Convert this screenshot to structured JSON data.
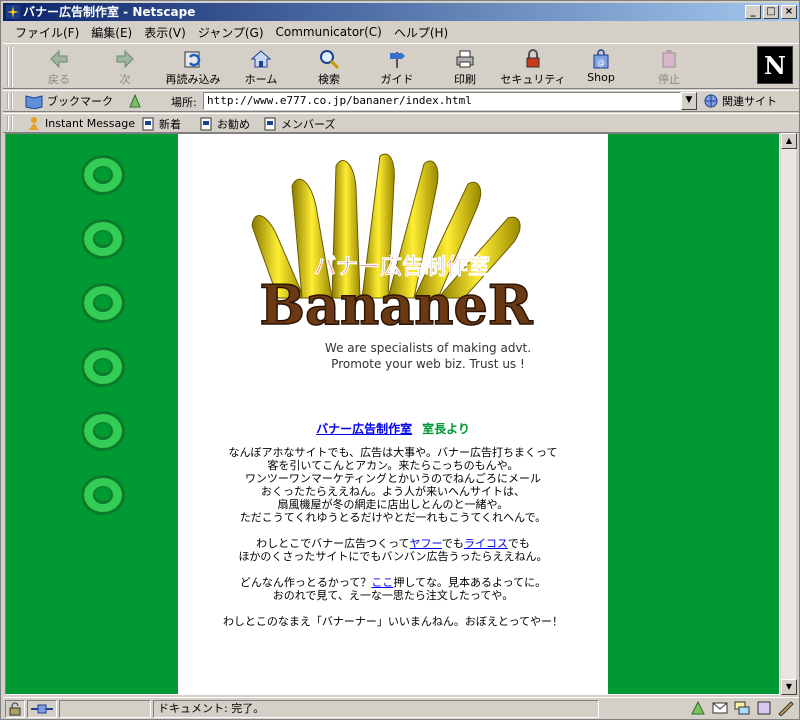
{
  "window": {
    "title": "バナー広告制作室 - Netscape"
  },
  "window_buttons": {
    "minimize": "_",
    "maximize": "□",
    "close": "×"
  },
  "menu": [
    "ファイル(F)",
    "編集(E)",
    "表示(V)",
    "ジャンプ(G)",
    "Communicator(C)",
    "ヘルプ(H)"
  ],
  "toolbar": {
    "back": "戻る",
    "forward": "次",
    "reload": "再読み込み",
    "home": "ホーム",
    "search": "検索",
    "guide": "ガイド",
    "print": "印刷",
    "security": "セキュリティ",
    "shop": "Shop",
    "stop": "停止"
  },
  "brand": {
    "logo_letter": "N"
  },
  "location": {
    "bookmarks_label": "ブックマーク",
    "label": "場所:",
    "url": "http://www.e777.co.jp/bananer/index.html",
    "related_label": "関連サイト"
  },
  "personal_toolbar": [
    "Instant Message",
    "新着",
    "お勧め",
    "メンバーズ"
  ],
  "banner": {
    "jp_title": "バナー広告制作室",
    "logo_text": "BananeR",
    "tagline1": "We are specialists of making advt.",
    "tagline2": "Promote your web biz. Trust us !"
  },
  "heading": {
    "link": "バナー広告制作室",
    "suffix": "室長より"
  },
  "paragraphs": {
    "p1": [
      "なんぼアホなサイトでも、広告は大事や。バナー広告打ちまくって",
      "客を引いてこんとアカン。来たらこっちのもんや。",
      "ワンツーワンマーケティングとかいうのでねんごろにメール",
      "おくったたらええねん。よう人が来いへんサイトは、",
      "扇風機屋が冬の網走に店出しとんのと一緒や。",
      "ただこうてくれゆうとるだけやとだ一れもこうてくれへんで。"
    ],
    "p2_a": "わしとこでバナー広告つくって",
    "p2_link1": "ヤフー",
    "p2_b": "でも",
    "p2_link2": "ライコス",
    "p2_c": "でも",
    "p2_line2": "ほかのくさったサイトにでもバンバン広告うったらええねん。",
    "p3_a": "どんなん作っとるかって？",
    "p3_link": "ここ",
    "p3_b": "押してな。見本あるよってに。",
    "p3_line2": "おのれで見て、え一な一思たら注文したってや。",
    "p4": "わしとこのなまえ「バナーナー」いいまんねん。おぼえとってやー！"
  },
  "status": {
    "text": "ドキュメント: 完了。"
  }
}
